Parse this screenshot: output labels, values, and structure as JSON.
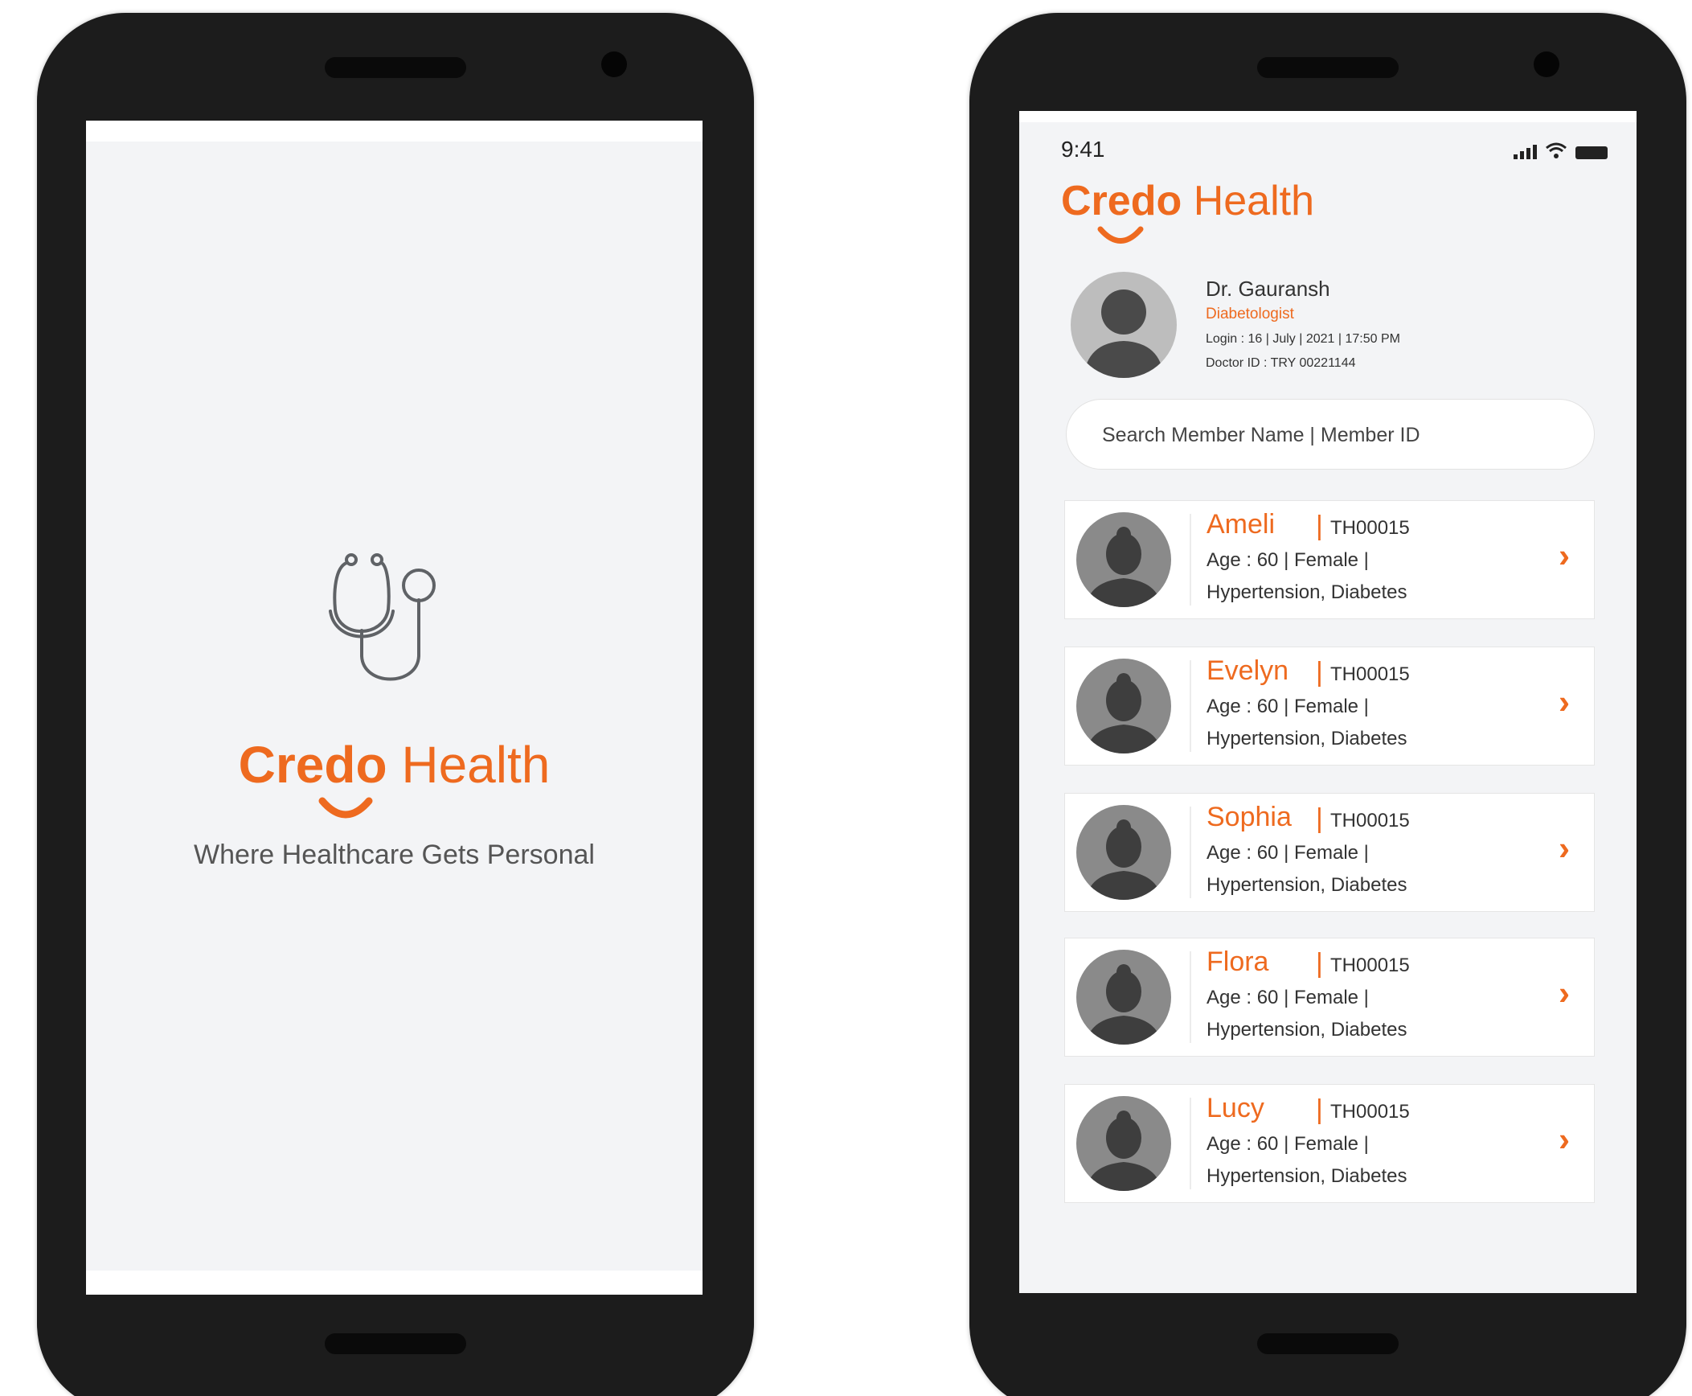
{
  "colors": {
    "brand_orange": "#ee6a1f",
    "phone_body": "#1c1c1c",
    "screen_bg": "#f3f4f6"
  },
  "splash": {
    "logo_credo": "Credo",
    "logo_health": "Health",
    "tagline": "Where Healthcare Gets Personal",
    "icon": "stethoscope-icon"
  },
  "dashboard": {
    "status": {
      "time": "9:41",
      "icons": [
        "signal-icon",
        "wifi-icon",
        "battery-icon"
      ]
    },
    "logo_credo": "Credo",
    "logo_health": "Health",
    "doctor": {
      "name": "Dr. Gauransh",
      "specialty": "Diabetologist",
      "login": "Login : 16 | July | 2021  | 17:50 PM",
      "doctor_id": "Doctor ID : TRY 00221144"
    },
    "search": {
      "placeholder": "Search Member Name | Member ID"
    },
    "patients": [
      {
        "name": "Ameli",
        "id": "TH00015",
        "info": "Age : 60 | Female |",
        "conditions": "Hypertension, Diabetes"
      },
      {
        "name": "Evelyn",
        "id": "TH00015",
        "info": "Age : 60 | Female |",
        "conditions": "Hypertension, Diabetes"
      },
      {
        "name": "Sophia",
        "id": "TH00015",
        "info": "Age : 60 | Female |",
        "conditions": "Hypertension, Diabetes"
      },
      {
        "name": "Flora",
        "id": "TH00015",
        "info": "Age : 60 | Female |",
        "conditions": "Hypertension, Diabetes"
      },
      {
        "name": "Lucy",
        "id": "TH00015",
        "info": "Age : 60 | Female |",
        "conditions": "Hypertension, Diabetes"
      }
    ]
  }
}
